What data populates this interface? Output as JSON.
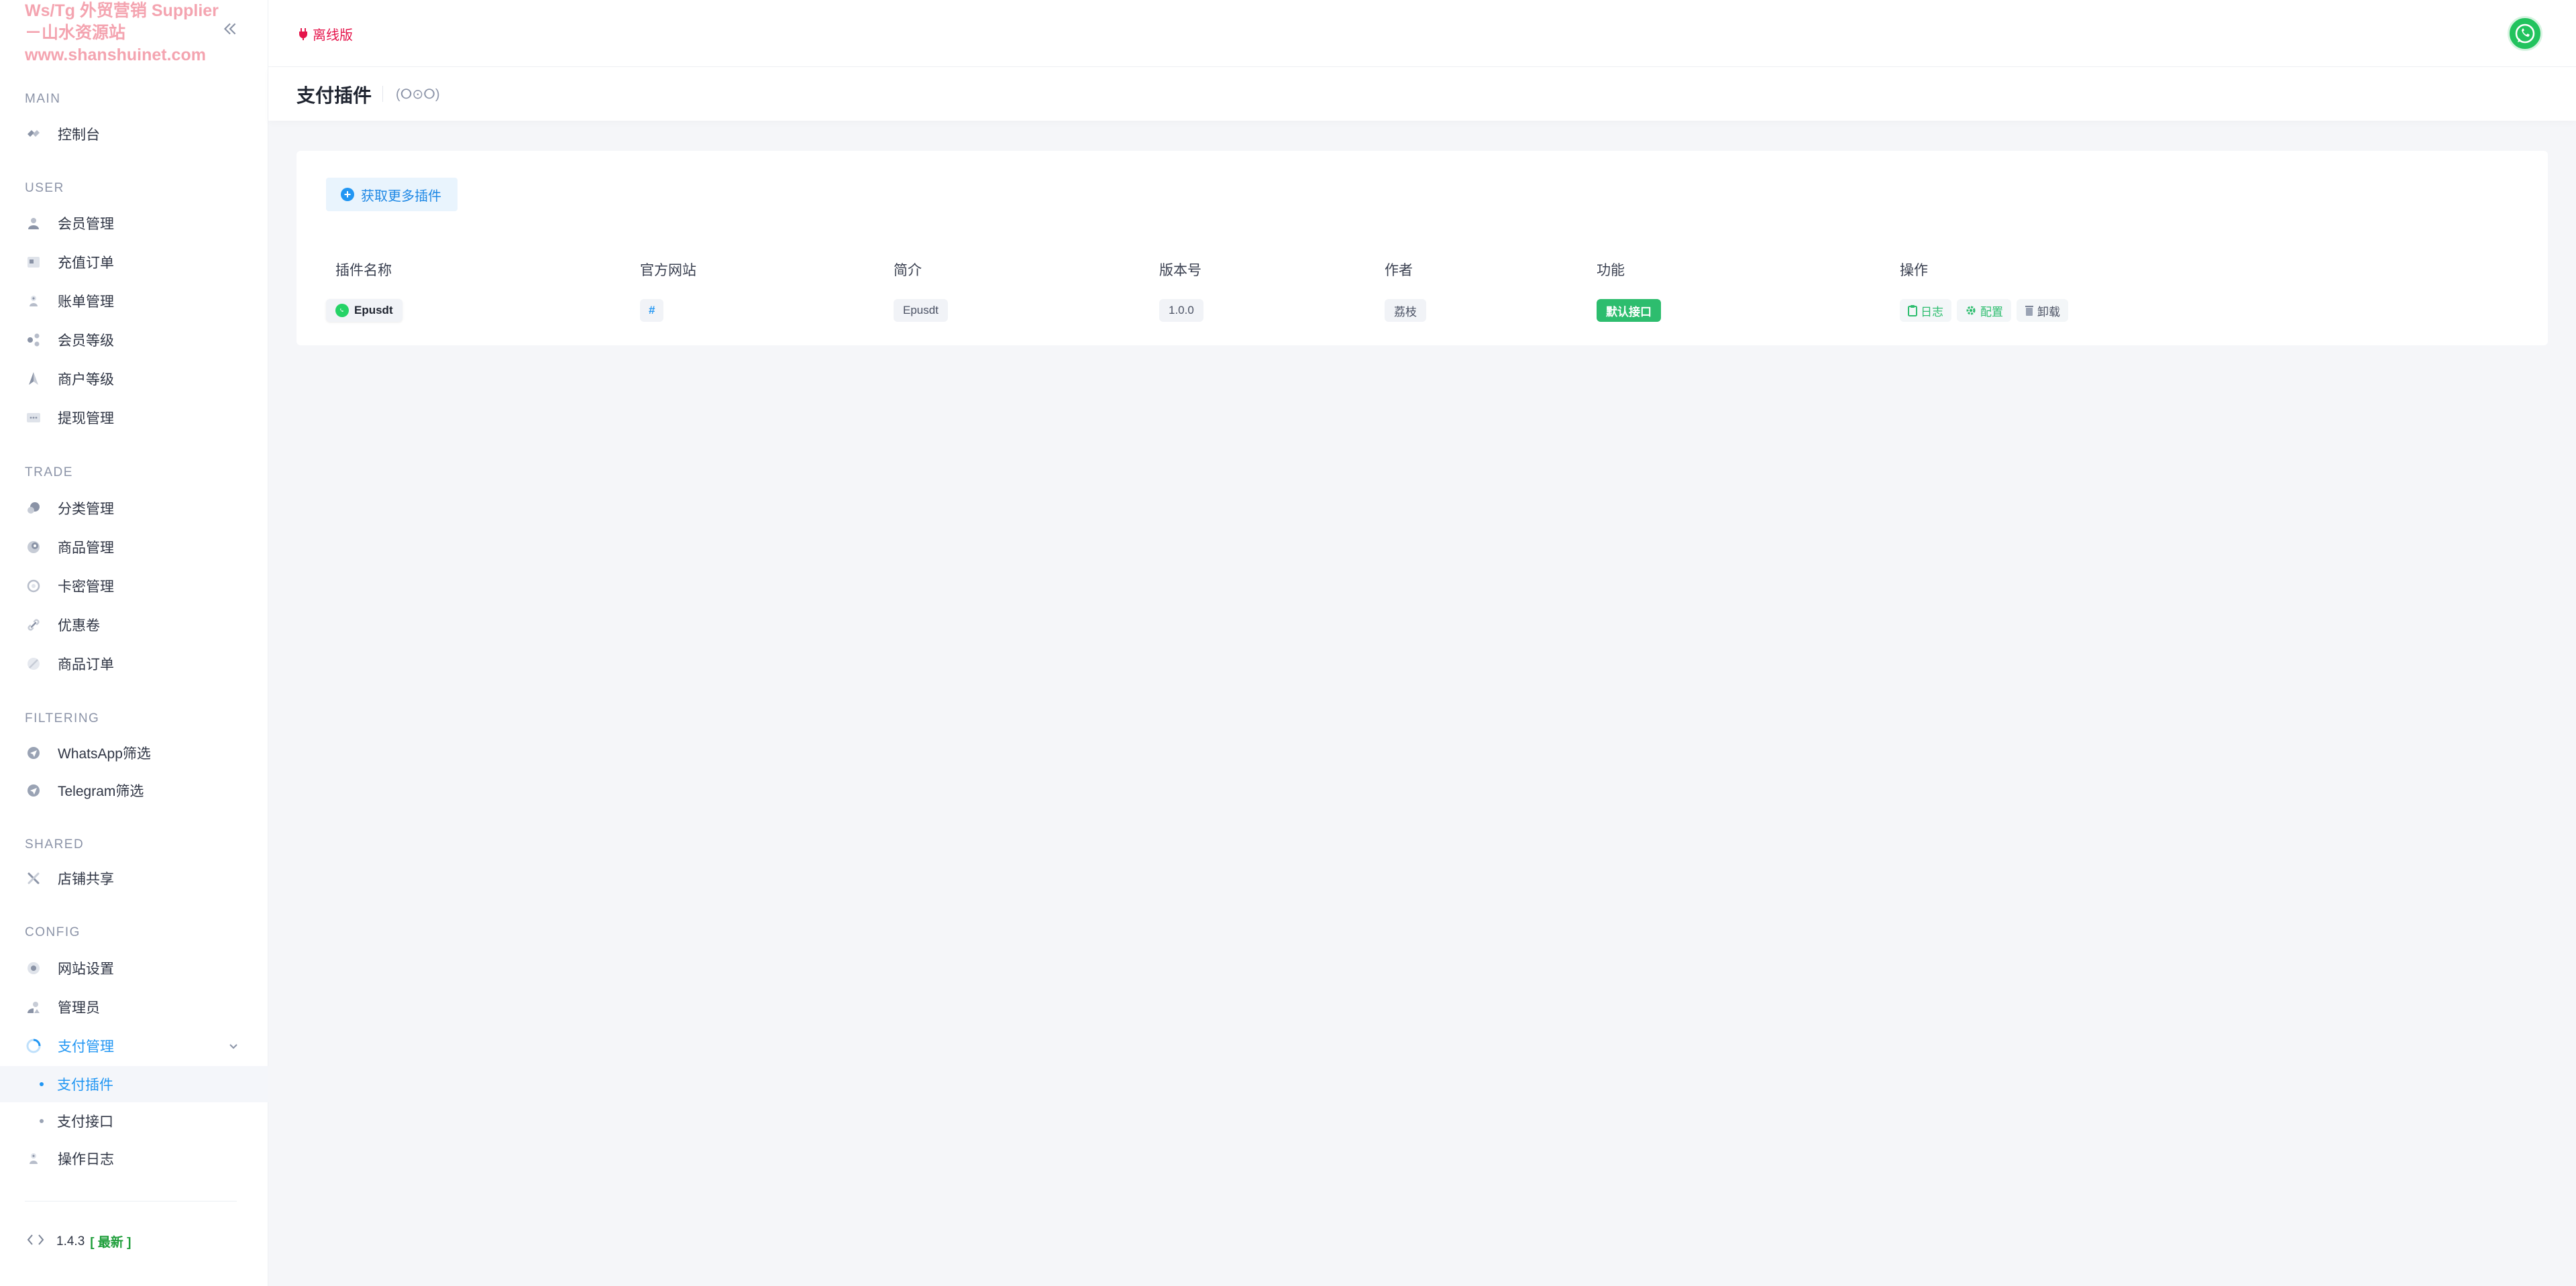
{
  "brand": {
    "line1": "Ws/Tg 外贸营销 Supplier",
    "line2": "－山水资源站",
    "line3": "www.shanshuinet.com"
  },
  "sidebar": {
    "sections": {
      "main": "MAIN",
      "user": "USER",
      "trade": "TRADE",
      "filtering": "FILTERING",
      "shared": "SHARED",
      "config": "CONFIG"
    },
    "items": {
      "dashboard": "控制台",
      "members": "会员管理",
      "recharge_orders": "充值订单",
      "bills": "账单管理",
      "member_levels": "会员等级",
      "merchant_levels": "商户等级",
      "withdrawals": "提现管理",
      "categories": "分类管理",
      "products": "商品管理",
      "card_keys": "卡密管理",
      "coupons": "优惠卷",
      "product_orders": "商品订单",
      "whatsapp_filter": "WhatsApp筛选",
      "telegram_filter": "Telegram筛选",
      "shop_share": "店铺共享",
      "site_settings": "网站设置",
      "admins": "管理员",
      "payment_mgmt": "支付管理",
      "payment_plugins": "支付插件",
      "payment_interfaces": "支付接口",
      "operation_logs": "操作日志"
    },
    "version": "1.4.3",
    "version_tag": "[ 最新 ]"
  },
  "topbar": {
    "offline_label": "离线版"
  },
  "page": {
    "title": "支付插件",
    "subtitle": "(ⵔ⊙ⵔ)"
  },
  "card": {
    "more_button": "获取更多插件",
    "columns": [
      "插件名称",
      "官方网站",
      "简介",
      "版本号",
      "作者",
      "功能",
      "操作"
    ],
    "row": {
      "name": "Epusdt",
      "website": "#",
      "intro": "Epusdt",
      "version": "1.0.0",
      "author": "荔枝",
      "feature": "默认接口",
      "actions": {
        "log": "日志",
        "config": "配置",
        "uninstall": "卸载"
      }
    }
  },
  "colors": {
    "accent": "#2196f3",
    "offline": "#e5154b",
    "success": "#2dbd6e",
    "brand_watermark": "#f4a4b0"
  }
}
